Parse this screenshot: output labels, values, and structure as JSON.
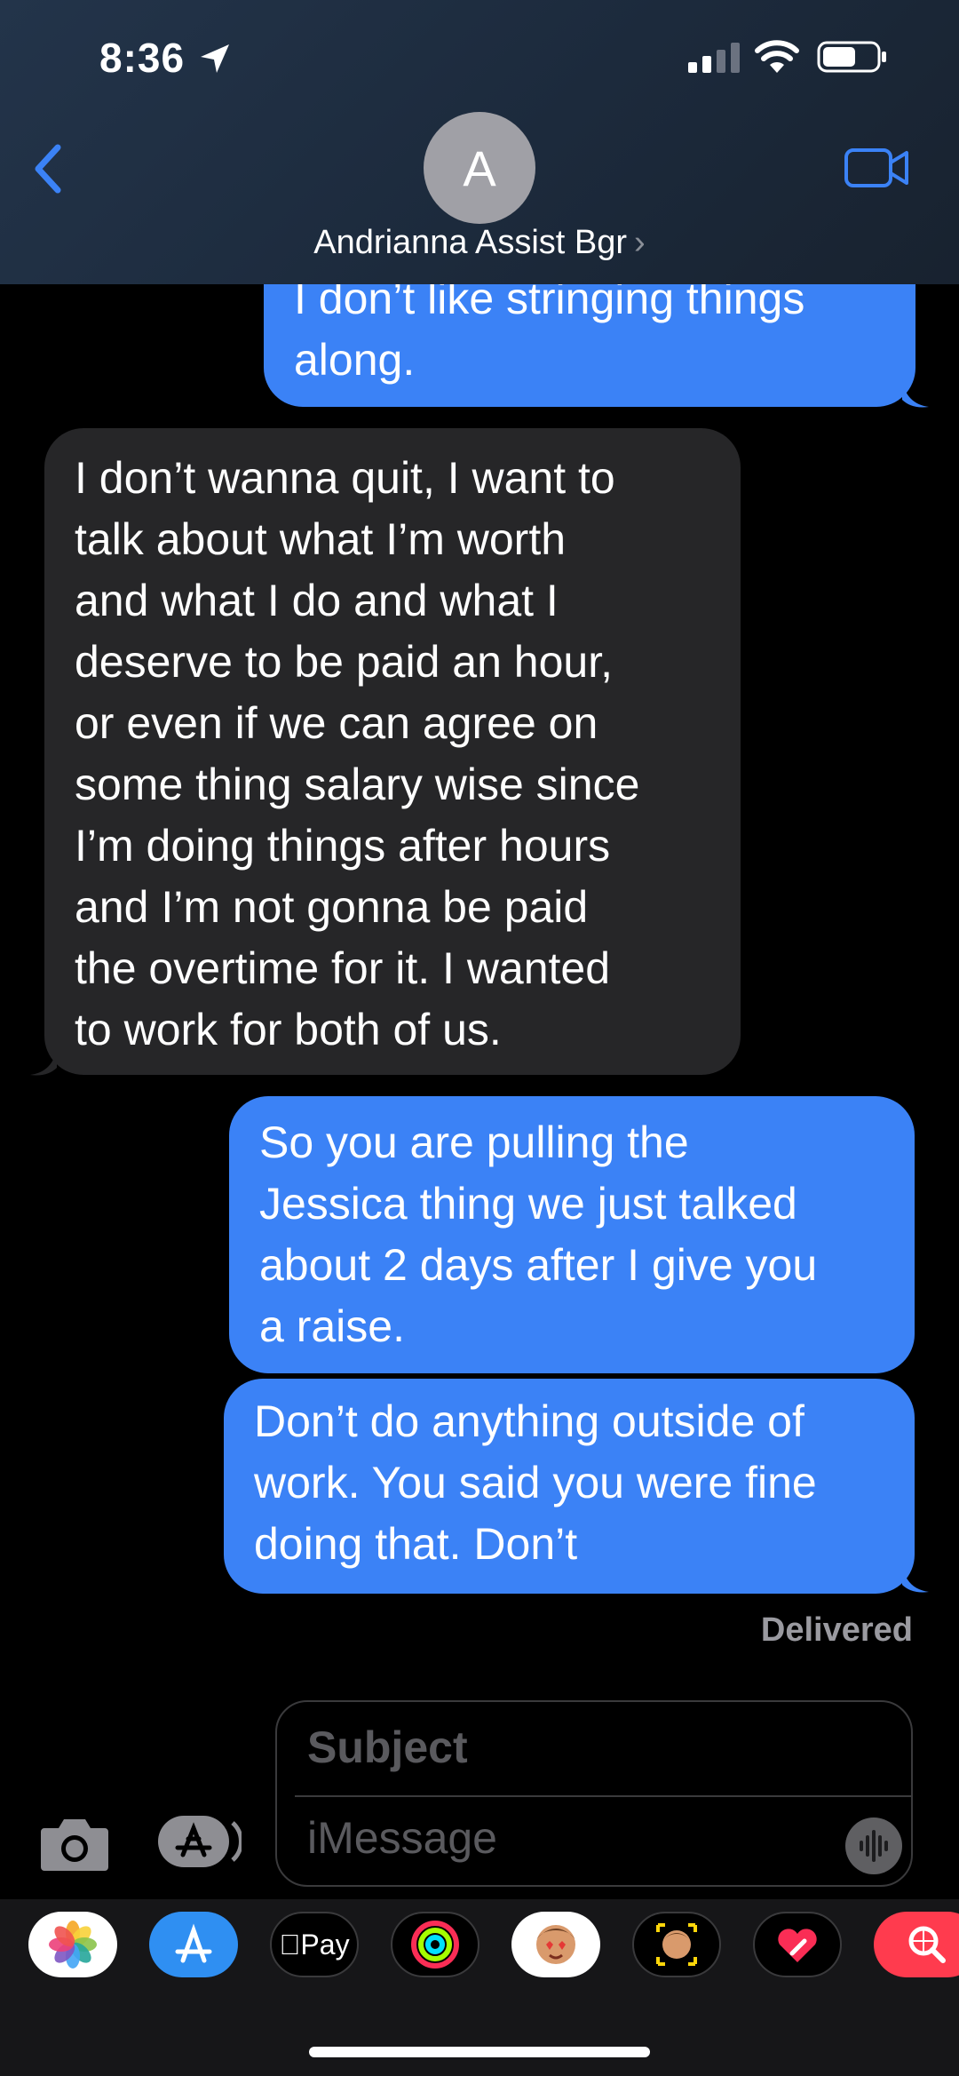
{
  "status_bar": {
    "time": "8:36"
  },
  "header": {
    "avatar_initial": "A",
    "contact_name": "Andrianna Assist Bgr",
    "contact_chevron": "›"
  },
  "messages": [
    {
      "direction": "outgoing",
      "text": "I don’t like stringing things\nalong."
    },
    {
      "direction": "incoming",
      "text": "I don’t wanna quit, I want to\ntalk about what I’m worth\nand what I do and what I\ndeserve to be paid an hour,\nor even if we can agree on\nsome thing salary wise since\nI’m doing things after hours\nand I’m not gonna be paid\nthe overtime for it. I wanted\nto work for both of us."
    },
    {
      "direction": "outgoing",
      "text": "So you are pulling the\nJessica thing we just talked\nabout 2 days after I give you\na raise."
    },
    {
      "direction": "outgoing",
      "text": "Don’t do anything outside of\nwork. You said you were fine\ndoing that. Don’t"
    }
  ],
  "delivered_label": "Delivered",
  "compose": {
    "subject_placeholder": "Subject",
    "message_placeholder": "iMessage"
  },
  "app_drawer": [
    {
      "name": "photos-app-icon"
    },
    {
      "name": "app-store-icon"
    },
    {
      "name": "apple-pay-icon",
      "label": "Pay"
    },
    {
      "name": "activity-icon"
    },
    {
      "name": "memoji-stickers-icon"
    },
    {
      "name": "memoji-camera-icon"
    },
    {
      "name": "digital-touch-icon"
    },
    {
      "name": "images-search-icon"
    }
  ],
  "colors": {
    "outgoing_bubble": "#3b82f6",
    "incoming_bubble": "#262628",
    "accent": "#3b82f6"
  }
}
